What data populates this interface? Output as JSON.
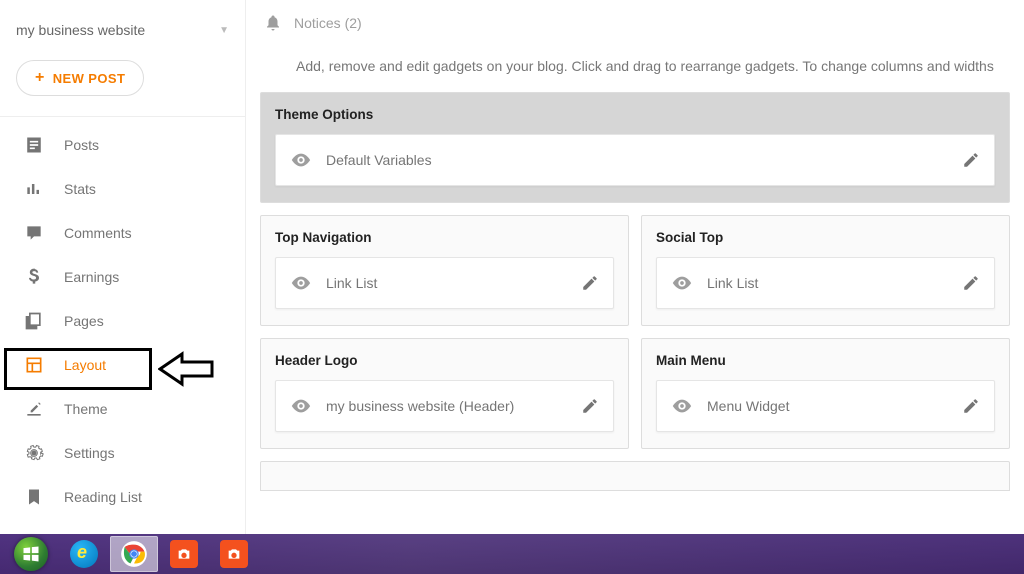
{
  "blog": {
    "name": "my business website"
  },
  "newPost": {
    "label": "NEW POST"
  },
  "sidebar": {
    "items": [
      {
        "label": "Posts"
      },
      {
        "label": "Stats"
      },
      {
        "label": "Comments"
      },
      {
        "label": "Earnings"
      },
      {
        "label": "Pages"
      },
      {
        "label": "Layout"
      },
      {
        "label": "Theme"
      },
      {
        "label": "Settings"
      },
      {
        "label": "Reading List"
      }
    ]
  },
  "notices": {
    "text": "Notices (2)"
  },
  "instructions": "Add, remove and edit gadgets on your blog. Click and drag to rearrange gadgets. To change columns and widths",
  "sections": {
    "themeOptions": {
      "title": "Theme Options",
      "gadget": "Default Variables"
    },
    "topNav": {
      "title": "Top Navigation",
      "gadget": "Link List"
    },
    "socialTop": {
      "title": "Social Top",
      "gadget": "Link List"
    },
    "headerLogo": {
      "title": "Header Logo",
      "gadget": "my business website (Header)"
    },
    "mainMenu": {
      "title": "Main Menu",
      "gadget": "Menu Widget"
    }
  }
}
